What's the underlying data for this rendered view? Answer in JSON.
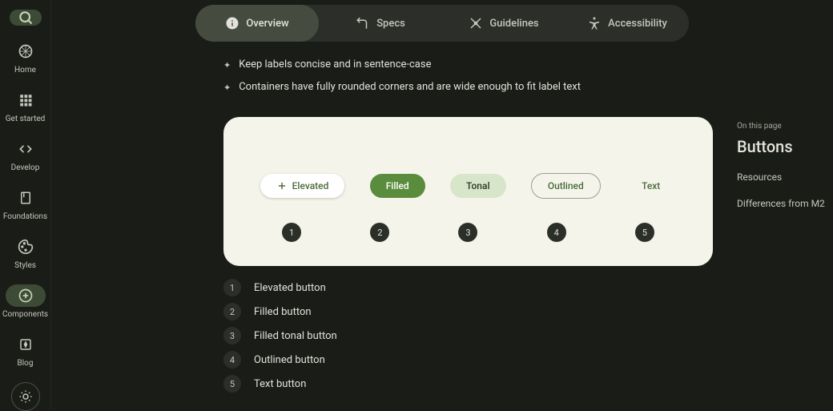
{
  "sidebar": {
    "items": [
      {
        "label": "Home"
      },
      {
        "label": "Get started"
      },
      {
        "label": "Develop"
      },
      {
        "label": "Foundations"
      },
      {
        "label": "Styles"
      },
      {
        "label": "Components"
      },
      {
        "label": "Blog"
      }
    ]
  },
  "tabs": [
    {
      "label": "Overview"
    },
    {
      "label": "Specs"
    },
    {
      "label": "Guidelines"
    },
    {
      "label": "Accessibility"
    }
  ],
  "bullets": [
    "Keep labels concise and in sentence-case",
    "Containers have fully rounded corners and are wide enough to fit label text"
  ],
  "example_buttons": [
    {
      "label": "Elevated"
    },
    {
      "label": "Filled"
    },
    {
      "label": "Tonal"
    },
    {
      "label": "Outlined"
    },
    {
      "label": "Text"
    }
  ],
  "numbers": [
    "1",
    "2",
    "3",
    "4",
    "5"
  ],
  "legend": [
    {
      "num": "1",
      "text": "Elevated button"
    },
    {
      "num": "2",
      "text": "Filled button"
    },
    {
      "num": "3",
      "text": "Filled tonal button"
    },
    {
      "num": "4",
      "text": "Outlined button"
    },
    {
      "num": "5",
      "text": "Text button"
    }
  ],
  "toc": {
    "label": "On this page",
    "title": "Buttons",
    "links": [
      "Resources",
      "Differences from M2"
    ]
  }
}
